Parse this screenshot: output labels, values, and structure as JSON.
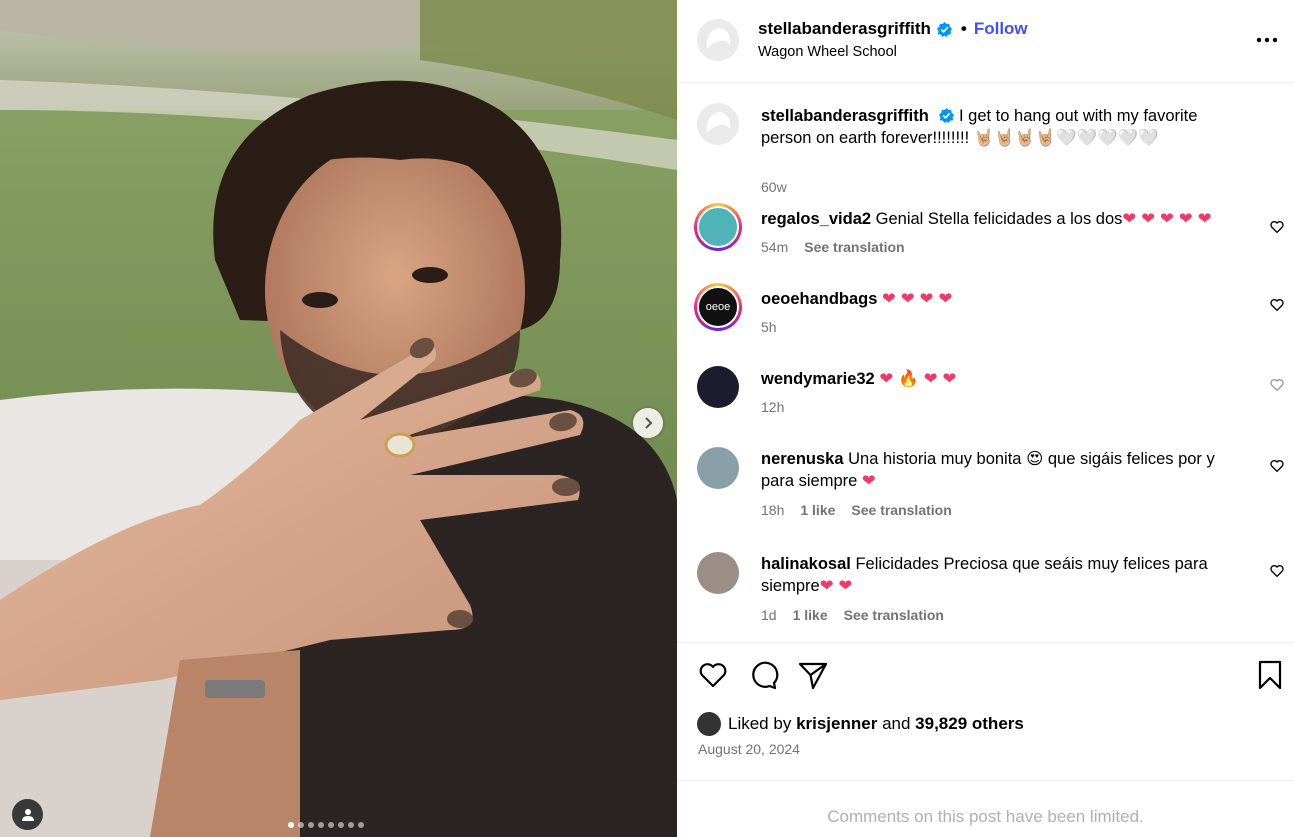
{
  "post": {
    "username": "stellabanderasgriffith",
    "location": "Wagon Wheel School",
    "follow_label": "Follow",
    "separator": "•",
    "carousel_count": 8,
    "carousel_active": 1
  },
  "caption": {
    "username": "stellabanderasgriffith",
    "text": "I get to hang out with my favorite person on earth forever!!!!!!!!",
    "emoji": "🤘🏼🤘🏼🤘🏼🤘🏼🤍🤍🤍🤍🤍",
    "time": "60w"
  },
  "comments": [
    {
      "username": "regalos_vida2",
      "text": "Genial Stella felicidades a los dos",
      "hearts": "❤❤❤❤❤",
      "time": "54m",
      "likes": "",
      "translate": "See translation"
    },
    {
      "username": "oeoehandbags",
      "text": "",
      "hearts": "❤❤❤❤",
      "time": "5h",
      "likes": "",
      "translate": ""
    },
    {
      "username": "wendymarie32",
      "text": "",
      "hearts": "❤🔥❤❤",
      "time": "12h",
      "likes": "",
      "translate": ""
    },
    {
      "username": "nerenuska",
      "text": "Una historia muy bonita 😍 que sigáis felices por y para siempre",
      "hearts": "❤",
      "time": "18h",
      "likes": "1 like",
      "translate": "See translation"
    },
    {
      "username": "halinakosal",
      "text": "Felicidades Preciosa que seáis muy felices para siempre",
      "hearts": "❤❤",
      "time": "1d",
      "likes": "1 like",
      "translate": "See translation"
    }
  ],
  "likes": {
    "prefix": "Liked by",
    "user": "krisjenner",
    "middle": "and",
    "others": "39,829 others"
  },
  "date": "August 20, 2024",
  "comments_limited": "Comments on this post have been limited.",
  "colors": {
    "accent": "#4150f7",
    "verified": "#0095f6",
    "heart": "#f0386b",
    "muted": "#737373"
  },
  "icons": [
    "chevron-right-icon",
    "user-tag-icon",
    "verified-icon",
    "more-icon",
    "heart-icon",
    "comment-icon",
    "share-icon",
    "bookmark-icon"
  ]
}
